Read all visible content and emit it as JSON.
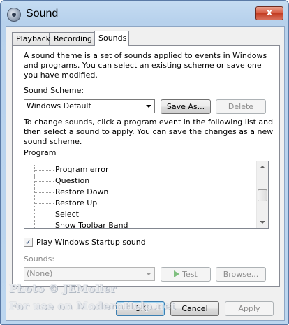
{
  "window": {
    "title": "Sound",
    "close_label": "x",
    "icon": "speaker-icon"
  },
  "tabs": [
    {
      "label": "Playback"
    },
    {
      "label": "Recording"
    },
    {
      "label": "Sounds",
      "active": true
    }
  ],
  "sounds": {
    "intro": "A sound theme is a set of sounds applied to events in Windows and programs.  You can select an existing scheme or save one you have modified.",
    "scheme_label": "Sound Scheme:",
    "scheme_value": "Windows Default",
    "save_as_label": "Save As...",
    "delete_label": "Delete",
    "change_help": "To change sounds, click a program event in the following list and then select a sound to apply.  You can save the changes as a new sound scheme.",
    "program_label": "Program",
    "program_items": [
      {
        "label": "Program error"
      },
      {
        "label": "Question"
      },
      {
        "label": "Restore Down"
      },
      {
        "label": "Restore Up"
      },
      {
        "label": "Select"
      },
      {
        "label": "Show Toolbar Band"
      }
    ],
    "startup_sound_label": "Play Windows Startup sound",
    "startup_sound_checked": true,
    "sounds_label": "Sounds:",
    "sounds_value": "(None)",
    "test_label": "Test",
    "browse_label": "Browse..."
  },
  "footer": {
    "ok_label": "OK",
    "cancel_label": "Cancel",
    "apply_label": "Apply"
  },
  "watermark": {
    "line1": "Photo © JEMoller",
    "line2": "For use on ModernHelp.net"
  },
  "colors": {
    "frame": "#bcd6ef",
    "close_button": "#c9442a",
    "test_icon": "#3aa53a"
  }
}
